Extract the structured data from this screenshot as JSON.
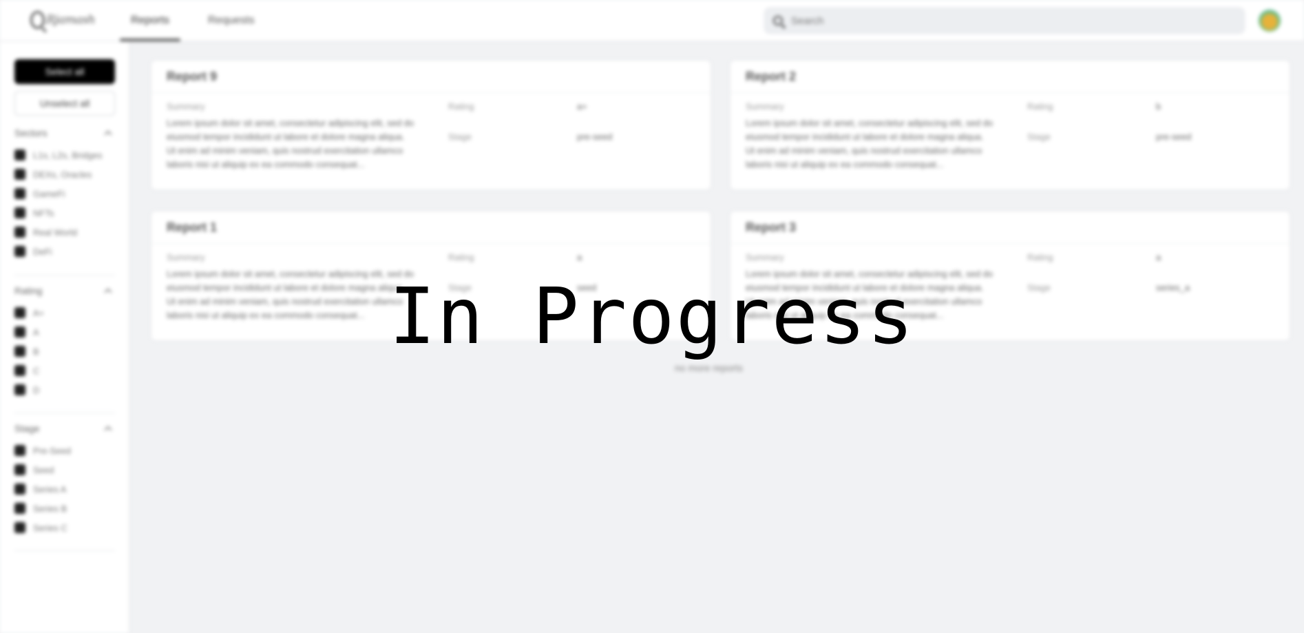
{
  "overlay_text": "In Progress",
  "header": {
    "logo_text": "Rjamash",
    "tabs": [
      {
        "label": "Reports"
      },
      {
        "label": "Requests"
      }
    ],
    "search_placeholder": "Search"
  },
  "sidebar": {
    "select_all": "Select all",
    "unselect_all": "Unselect all",
    "sectors": {
      "title": "Sectors",
      "options": [
        "L1s, L2s, Bridges",
        "DEXs, Oracles",
        "GameFi",
        "NFTs",
        "Real World",
        "DeFi"
      ]
    },
    "rating": {
      "title": "Rating",
      "options": [
        "A+",
        "A",
        "B",
        "C",
        "D"
      ]
    },
    "stage": {
      "title": "Stage",
      "options": [
        "Pre-Seed",
        "Seed",
        "Series A",
        "Series B",
        "Series C"
      ]
    }
  },
  "reports": [
    {
      "title": "Report 9",
      "summary_label": "Summary",
      "summary": "Lorem ipsum dolor sit amet, consectetur adipiscing elit, sed do eiusmod tempor incididunt ut labore et dolore magna aliqua. Ut enim ad minim veniam, quis nostrud exercitation ullamco laboris nisi ut aliquip ex ea commodo consequat...",
      "rating_label": "Rating",
      "rating": "a+",
      "stage_label": "Stage",
      "stage": "pre-seed"
    },
    {
      "title": "Report 2",
      "summary_label": "Summary",
      "summary": "Lorem ipsum dolor sit amet, consectetur adipiscing elit, sed do eiusmod tempor incididunt ut labore et dolore magna aliqua. Ut enim ad minim veniam, quis nostrud exercitation ullamco laboris nisi ut aliquip ex ea commodo consequat...",
      "rating_label": "Rating",
      "rating": "b",
      "stage_label": "Stage",
      "stage": "pre-seed"
    },
    {
      "title": "Report 1",
      "summary_label": "Summary",
      "summary": "Lorem ipsum dolor sit amet, consectetur adipiscing elit, sed do eiusmod tempor incididunt ut labore et dolore magna aliqua. Ut enim ad minim veniam, quis nostrud exercitation ullamco laboris nisi ut aliquip ex ea commodo consequat...",
      "rating_label": "Rating",
      "rating": "a",
      "stage_label": "Stage",
      "stage": "seed"
    },
    {
      "title": "Report 3",
      "summary_label": "Summary",
      "summary": "Lorem ipsum dolor sit amet, consectetur adipiscing elit, sed do eiusmod tempor incididunt ut labore et dolore magna aliqua. Ut enim ad minim veniam, quis nostrud exercitation ullamco laboris nisi ut aliquip ex ea commodo consequat...",
      "rating_label": "Rating",
      "rating": "a",
      "stage_label": "Stage",
      "stage": "series_a"
    }
  ],
  "no_more_text": "no more reports"
}
